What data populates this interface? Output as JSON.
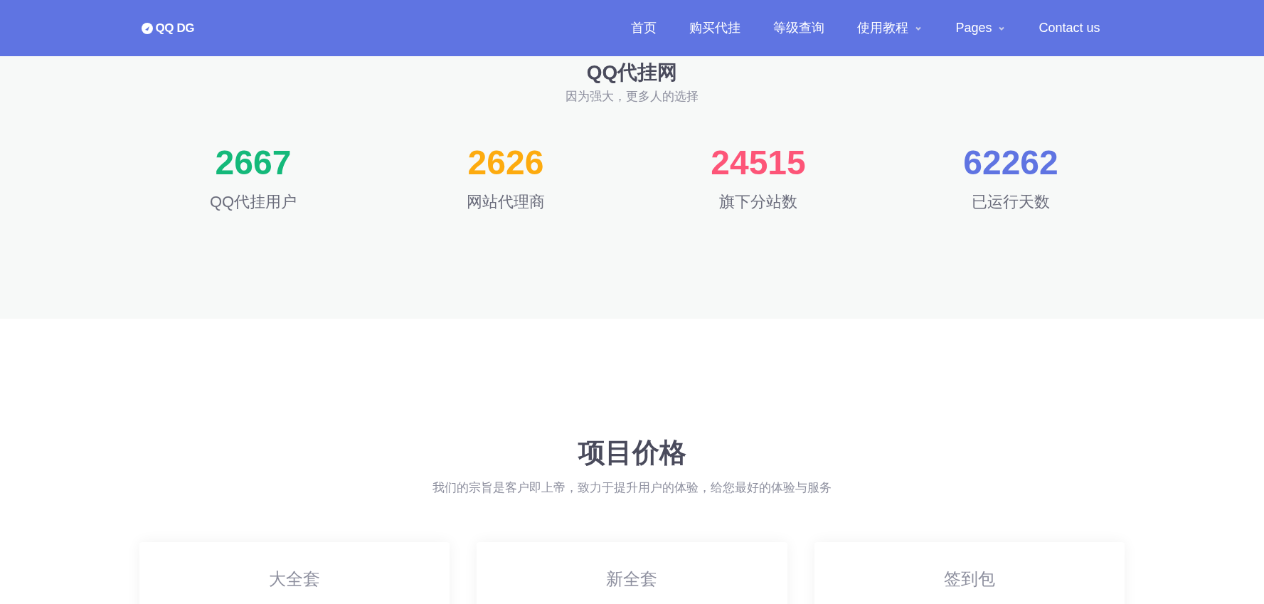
{
  "navbar": {
    "logo": "QQ DG",
    "items": [
      {
        "label": "首页",
        "dropdown": false
      },
      {
        "label": "购买代挂",
        "dropdown": false
      },
      {
        "label": "等级查询",
        "dropdown": false
      },
      {
        "label": "使用教程",
        "dropdown": true
      },
      {
        "label": "Pages",
        "dropdown": true
      },
      {
        "label": "Contact us",
        "dropdown": false
      }
    ]
  },
  "stats_section": {
    "title": "QQ代挂网",
    "subtitle": "因为强大，更多人的选择",
    "stats": [
      {
        "value": "2667",
        "label": "QQ代挂用户",
        "color": "#14b97a"
      },
      {
        "value": "2626",
        "label": "网站代理商",
        "color": "#fdab0f"
      },
      {
        "value": "24515",
        "label": "旗下分站数",
        "color": "#fd5578"
      },
      {
        "value": "62262",
        "label": "已运行天数",
        "color": "#5f74e2"
      }
    ]
  },
  "pricing_section": {
    "title": "项目价格",
    "subtitle": "我们的宗旨是客户即上帝，致力于提升用户的体验，给您最好的体验与服务",
    "plans": [
      {
        "name": "大全套"
      },
      {
        "name": "新全套"
      },
      {
        "name": "签到包"
      }
    ]
  }
}
